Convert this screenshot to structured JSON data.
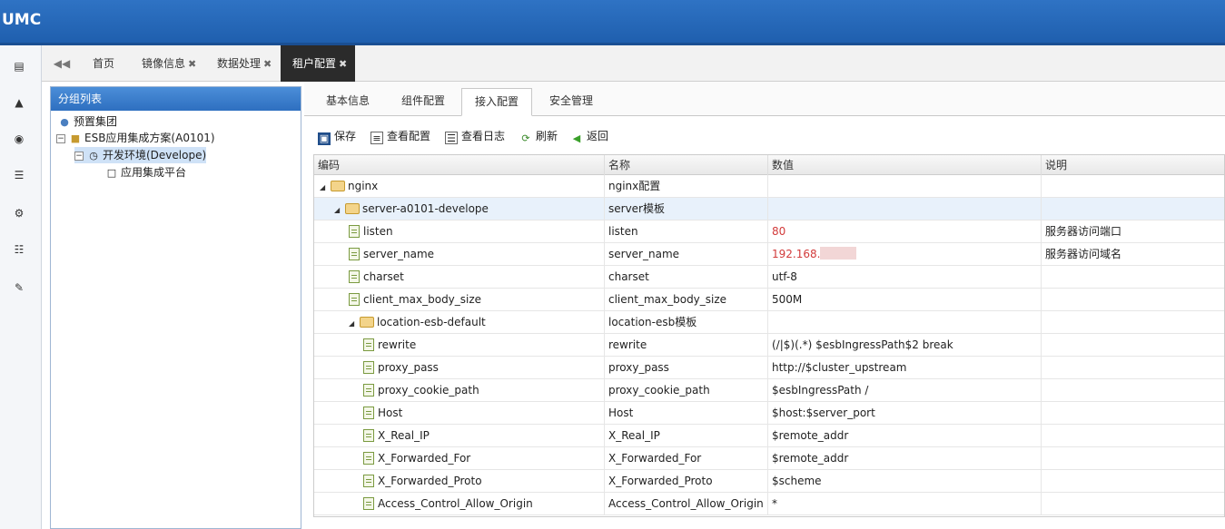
{
  "app": {
    "title": "UMC"
  },
  "rail": {
    "icons": [
      "id-card-icon",
      "bank-icon",
      "eye-icon",
      "list-icon",
      "gear-icon",
      "sitemap-icon",
      "wrench-icon"
    ]
  },
  "tabs": {
    "home": "首页",
    "mirror": "镜像信息",
    "data": "数据处理",
    "tenant": "租户配置",
    "close": "✖"
  },
  "leftpanel": {
    "title": "分组列表",
    "tree": [
      "预置集团",
      "ESB应用集成方案(A0101)",
      "开发环境(Develope)",
      "应用集成平台"
    ]
  },
  "subtabs": [
    "基本信息",
    "组件配置",
    "接入配置",
    "安全管理"
  ],
  "toolbar": {
    "save": "保存",
    "view_config": "查看配置",
    "view_log": "查看日志",
    "refresh": "刷新",
    "back": "返回"
  },
  "grid": {
    "headers": [
      "编码",
      "名称",
      "数值",
      "说明"
    ],
    "rows": [
      {
        "code": "nginx",
        "name": "nginx配置",
        "value": "",
        "desc": ""
      },
      {
        "code": "server-a0101-develope",
        "name": "server模板",
        "value": "",
        "desc": ""
      },
      {
        "code": "listen",
        "name": "listen",
        "value": "80",
        "desc": "服务器访问端口"
      },
      {
        "code": "server_name",
        "name": "server_name",
        "value": "192.168.",
        "desc": "服务器访问域名"
      },
      {
        "code": "charset",
        "name": "charset",
        "value": "utf-8",
        "desc": ""
      },
      {
        "code": "client_max_body_size",
        "name": "client_max_body_size",
        "value": "500M",
        "desc": ""
      },
      {
        "code": "location-esb-default",
        "name": "location-esb模板",
        "value": "",
        "desc": ""
      },
      {
        "code": "rewrite",
        "name": "rewrite",
        "value": "(/|$)(.*) $esbIngressPath$2 break",
        "desc": ""
      },
      {
        "code": "proxy_pass",
        "name": "proxy_pass",
        "value": "http://$cluster_upstream",
        "desc": ""
      },
      {
        "code": "proxy_cookie_path",
        "name": "proxy_cookie_path",
        "value": "$esbIngressPath /",
        "desc": ""
      },
      {
        "code": "Host",
        "name": "Host",
        "value": "$host:$server_port",
        "desc": ""
      },
      {
        "code": "X_Real_IP",
        "name": "X_Real_IP",
        "value": "$remote_addr",
        "desc": ""
      },
      {
        "code": "X_Forwarded_For",
        "name": "X_Forwarded_For",
        "value": "$remote_addr",
        "desc": ""
      },
      {
        "code": "X_Forwarded_Proto",
        "name": "X_Forwarded_Proto",
        "value": "$scheme",
        "desc": ""
      },
      {
        "code": "Access_Control_Allow_Origin",
        "name": "Access_Control_Allow_Origin",
        "value": "*",
        "desc": ""
      }
    ]
  },
  "colors": {
    "header_blue": "#2f73c4",
    "value_red": "#d23b3b"
  }
}
